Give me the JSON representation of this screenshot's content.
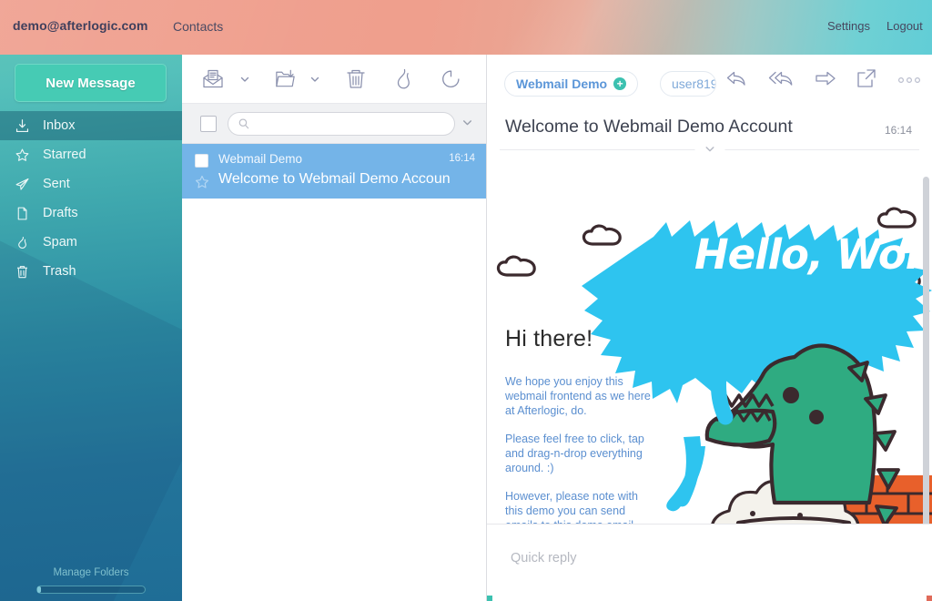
{
  "topbar": {
    "user_email": "demo@afterlogic.com",
    "contacts_label": "Contacts",
    "settings_label": "Settings",
    "logout_label": "Logout"
  },
  "sidebar": {
    "new_message_label": "New Message",
    "manage_folders_label": "Manage Folders",
    "quota_percent": 3,
    "folders": [
      {
        "label": "Inbox",
        "icon": "inbox-icon",
        "active": true
      },
      {
        "label": "Starred",
        "icon": "star-icon",
        "active": false
      },
      {
        "label": "Sent",
        "icon": "send-icon",
        "active": false
      },
      {
        "label": "Drafts",
        "icon": "file-icon",
        "active": false
      },
      {
        "label": "Spam",
        "icon": "flame-icon",
        "active": false
      },
      {
        "label": "Trash",
        "icon": "trash-icon",
        "active": false
      }
    ]
  },
  "message_list": {
    "toolbar": [
      {
        "icon": "mark-read-icon"
      },
      {
        "icon": "chevron-down-icon"
      },
      {
        "icon": "move-to-folder-icon"
      },
      {
        "icon": "chevron-down-icon"
      },
      {
        "icon": "trash-icon"
      },
      {
        "icon": "flame-icon"
      },
      {
        "icon": "refresh-icon"
      }
    ],
    "search_placeholder": "",
    "select_all_checked": false,
    "messages": [
      {
        "from": "Webmail Demo",
        "time": "16:14",
        "subject": "Welcome to Webmail Demo Accoun",
        "selected": true,
        "starred": false,
        "checked": false
      }
    ]
  },
  "reading_pane": {
    "from_label": "Webmail Demo",
    "arrow": "→",
    "to_label": "user819",
    "subject": "Welcome to Webmail Demo Account",
    "time": "16:14",
    "actions": [
      {
        "icon": "reply-icon"
      },
      {
        "icon": "reply-all-icon"
      },
      {
        "icon": "forward-icon"
      },
      {
        "icon": "open-external-icon"
      },
      {
        "icon": "more-options-icon"
      }
    ],
    "body": {
      "speech_bubble": "Hello, World!",
      "heading": "Hi there!",
      "paragraphs": [
        "We hope you enjoy this webmail frontend as we here at Afterlogic, do.",
        "Please feel free to click, tap and drag-n-drop everything around. :)",
        "However, please note with this demo you can send emails to this demo email account only. It's just not to allow folks to send spam"
      ]
    },
    "quick_reply_placeholder": "Quick reply"
  },
  "colors": {
    "accent_teal": "#46cbb4",
    "header_salmon": "#ef9d8c",
    "header_teal": "#61cdd6",
    "selection_blue": "#74b4e8",
    "body_link_blue": "#5b8fd0",
    "bubble_cyan": "#2ec4ef",
    "dino_green": "#2fab81"
  }
}
